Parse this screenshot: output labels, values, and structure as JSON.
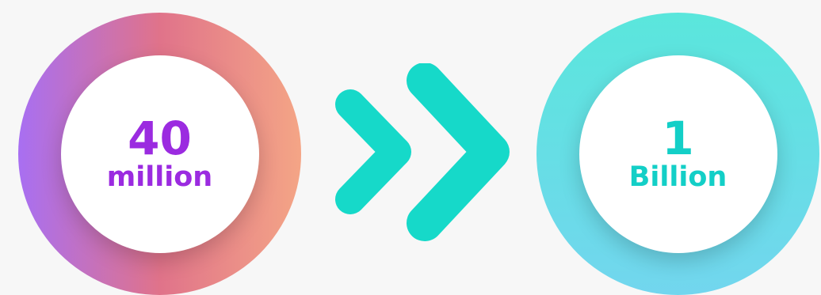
{
  "left_stat": {
    "number": "40",
    "unit": "million",
    "text_color": "#9b2be0",
    "ring_gradient": [
      "#a86ff2",
      "#e0738a",
      "#f4a586"
    ]
  },
  "right_stat": {
    "number": "1",
    "unit": "Billion",
    "text_color": "#13cfc7",
    "ring_gradient": [
      "#5ae6dc",
      "#72d6ee"
    ]
  },
  "arrow": {
    "icon": "double-chevron-right-icon",
    "color": "#16d9c9"
  },
  "background_color": "#f7f7f7"
}
